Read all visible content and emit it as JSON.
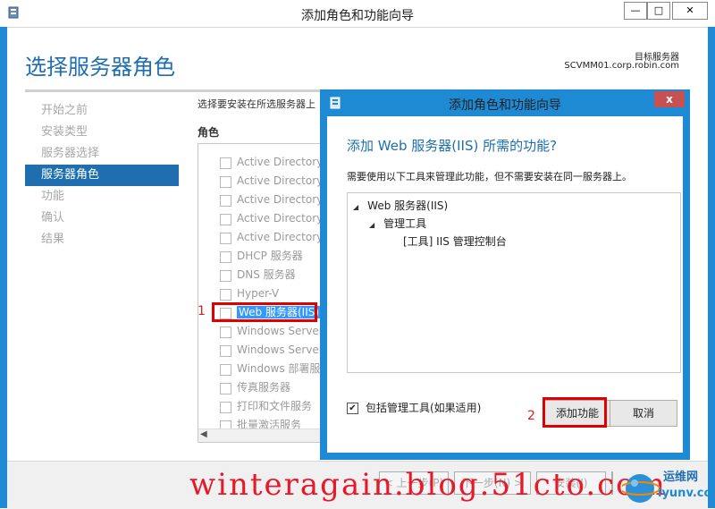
{
  "window": {
    "title": "添加角色和功能向导",
    "minimize": "—",
    "maximize": "□",
    "close": "✕"
  },
  "page": {
    "heading": "选择服务器角色",
    "target_label": "目标服务器",
    "target_value": "SCVMM01.corp.robin.com",
    "instruction": "选择要安装在所选服务器上",
    "role_header": "角色"
  },
  "nav": [
    "开始之前",
    "安装类型",
    "服务器选择",
    "服务器角色",
    "功能",
    "确认",
    "结果"
  ],
  "roles": [
    "Active Directory",
    "Active Directory",
    "Active Directory",
    "Active Directory",
    "Active Directory",
    "DHCP 服务器",
    "DNS 服务器",
    "Hyper-V",
    "Web 服务器(IIS)",
    "Windows Server",
    "Windows Server",
    "Windows 部署服",
    "传真服务器",
    "打印和文件服务",
    "批量激活服务"
  ],
  "annotations": {
    "one": "1",
    "two": "2"
  },
  "bottom_buttons": {
    "prev": "< 上一步(P)",
    "next": "下一步(N) >",
    "install": "安装(I)",
    "cancel": "取消"
  },
  "dialog": {
    "title": "添加角色和功能向导",
    "close": "x",
    "heading": "添加 Web 服务器(IIS) 所需的功能?",
    "description": "需要使用以下工具来管理此功能，但不需要安装在同一服务器上。",
    "tree": [
      "Web 服务器(IIS)",
      "管理工具",
      "[工具] IIS 管理控制台"
    ],
    "include_label": "包括管理工具(如果适用)",
    "add_button": "添加功能",
    "cancel_button": "取消"
  },
  "watermark": "winteragain.blog.51cto.com",
  "logo": {
    "line1": "运维网",
    "line2": "iyunv.com"
  },
  "colors": {
    "accent": "#1e6eb0",
    "frame": "#1e8ad3",
    "annotation": "#e00000"
  }
}
